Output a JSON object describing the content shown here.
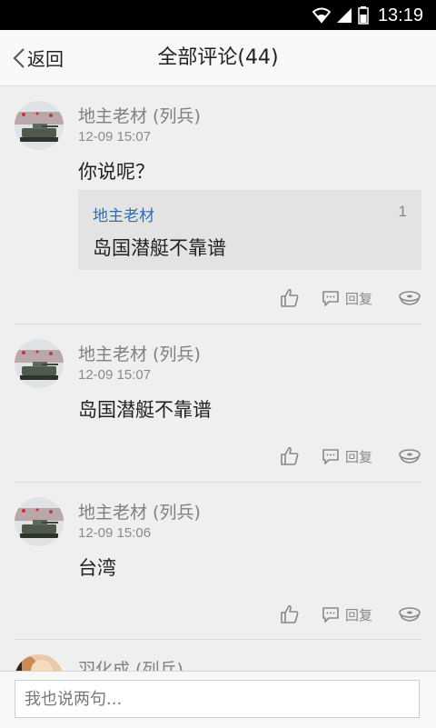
{
  "status_bar": {
    "time": "13:19"
  },
  "nav": {
    "back_label": "返回",
    "title": "全部评论(44)"
  },
  "comments": [
    {
      "author": "地主老材 (列兵)",
      "time": "12-09 15:07",
      "text": "你说呢？",
      "quote": {
        "author": "地主老材",
        "floor": "1",
        "text": "岛国潜艇不靠谱"
      },
      "reply_label": "回复"
    },
    {
      "author": "地主老材 (列兵)",
      "time": "12-09 15:07",
      "text": "岛国潜艇不靠谱",
      "reply_label": "回复"
    },
    {
      "author": "地主老材 (列兵)",
      "time": "12-09 15:06",
      "text": "台湾",
      "reply_label": "回复"
    },
    {
      "author": "羽化成 (列兵)"
    }
  ],
  "composer": {
    "placeholder": "我也说两句..."
  },
  "colors": {
    "link_blue": "#2e6db4",
    "background": "#efefef"
  }
}
